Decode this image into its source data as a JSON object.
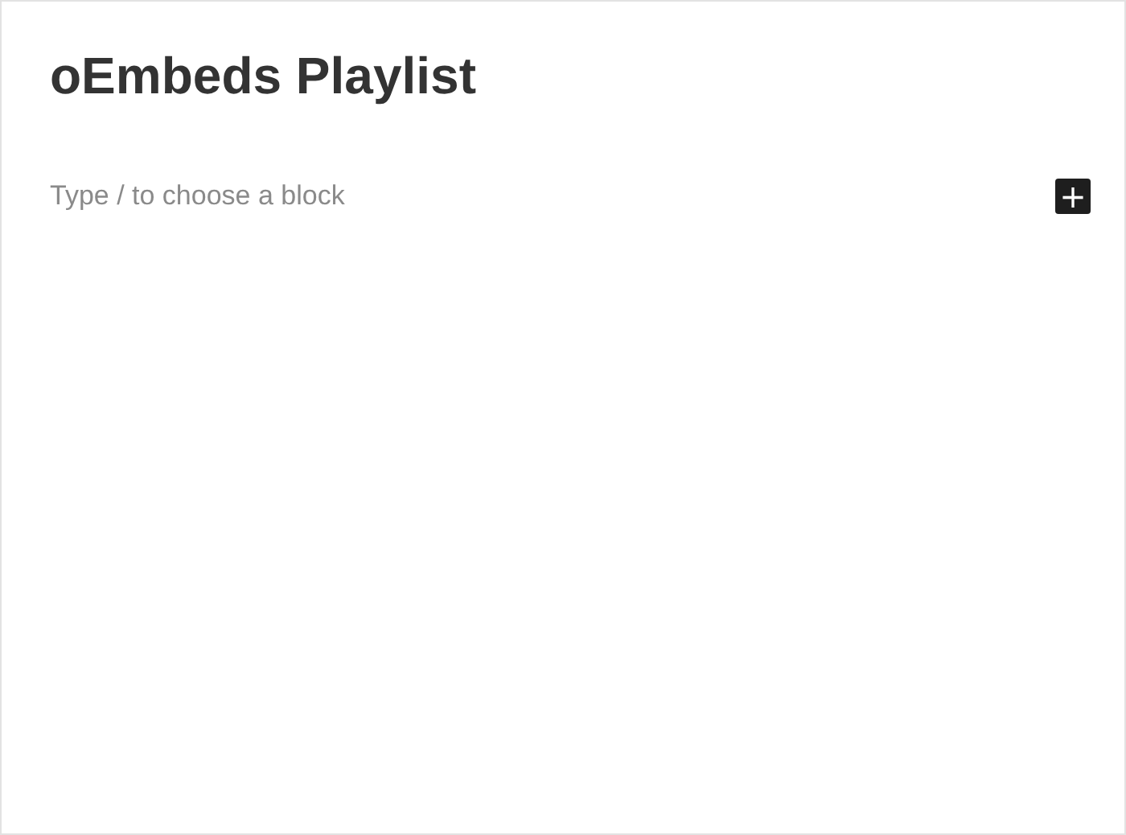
{
  "post_title": "oEmbeds Playlist",
  "block_input": {
    "placeholder": "Type / to choose a block"
  },
  "add_block_button": {
    "label": "+"
  }
}
